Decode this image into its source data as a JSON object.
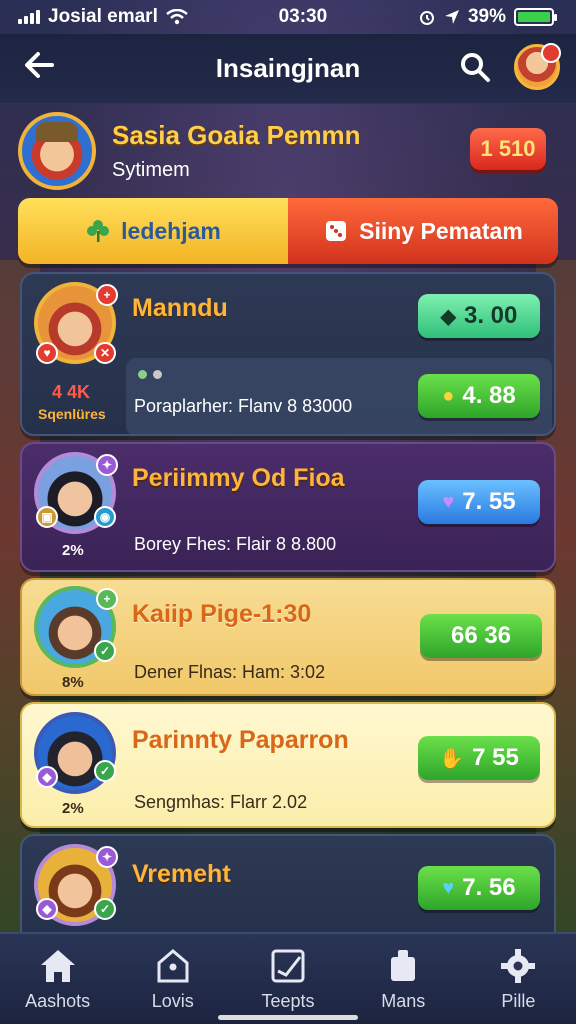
{
  "status_bar": {
    "carrier": "Josial emarl",
    "time": "03:30",
    "battery": "39%"
  },
  "header": {
    "title": "Insaingjnan"
  },
  "banner": {
    "title": "Sasia Goaia Pemmn",
    "subtitle": "Sytimem",
    "badge": "1 510"
  },
  "tabs": [
    {
      "label": "ledehjam",
      "icon": "clover-icon"
    },
    {
      "label": "Siiny Pematam",
      "icon": "dice-icon"
    }
  ],
  "cards": [
    {
      "name": "Manndu",
      "side_value": "4 4K",
      "side_label": "Sqenlüres",
      "stat": "Poraplarher: Flanv 8 83000",
      "score_primary": "3. 00",
      "score_secondary": "4. 88"
    },
    {
      "name": "Periimmy Od Fioa",
      "side_value": "2%",
      "stat": "Borey Fhes: Flair 8 8.800",
      "score_primary": "7. 55"
    },
    {
      "name": "Kaiip Pige-1:30",
      "side_value": "8%",
      "stat": "Dener Flnas: Ham: 3:02",
      "score_primary": "66 36"
    },
    {
      "name": "Parinnty Paparron",
      "side_value": "2%",
      "stat": "Sengmhas: Flarr 2.02",
      "score_primary": "7 55"
    },
    {
      "name": "Vremeht",
      "score_primary": "7. 56"
    }
  ],
  "bottom_nav": [
    {
      "label": "Aashots",
      "icon": "home-icon"
    },
    {
      "label": "Lovis",
      "icon": "house-outline-icon"
    },
    {
      "label": "Teepts",
      "icon": "ticket-icon"
    },
    {
      "label": "Mans",
      "icon": "bag-icon"
    },
    {
      "label": "Pille",
      "icon": "gear-icon"
    }
  ],
  "colors": {
    "accent_gold": "#f3b325",
    "accent_red": "#d2321e",
    "score_green": "#2ea52a",
    "score_blue": "#2a7ae0"
  }
}
